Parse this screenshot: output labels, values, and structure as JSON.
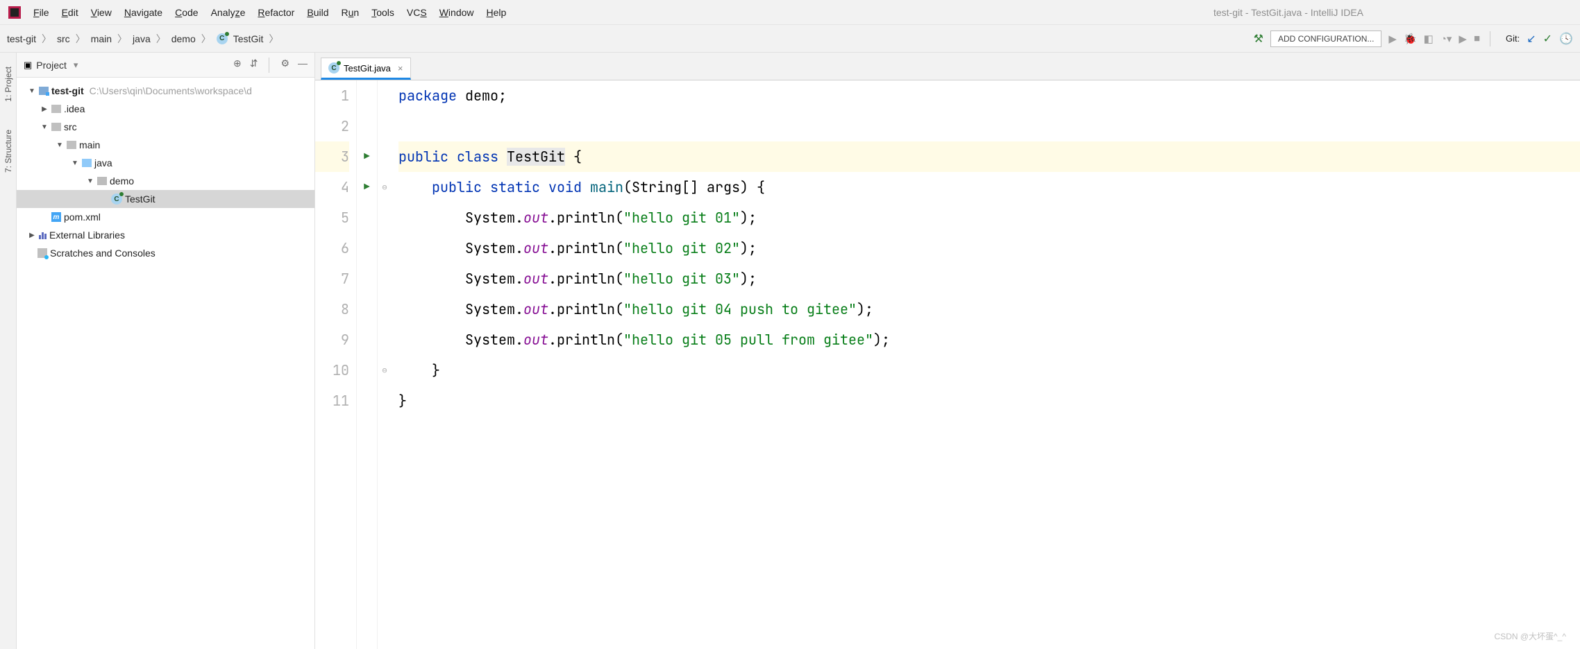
{
  "menu": {
    "items": [
      "File",
      "Edit",
      "View",
      "Navigate",
      "Code",
      "Analyze",
      "Refactor",
      "Build",
      "Run",
      "Tools",
      "VCS",
      "Window",
      "Help"
    ],
    "underline": [
      "F",
      "E",
      "V",
      "N",
      "C",
      "",
      "R",
      "B",
      "u",
      "T",
      "",
      "W",
      "H"
    ]
  },
  "window_title": "test-git - TestGit.java - IntelliJ IDEA",
  "breadcrumbs": [
    "test-git",
    "src",
    "main",
    "java",
    "demo",
    "TestGit"
  ],
  "toolbar": {
    "add_config": "ADD CONFIGURATION...",
    "git_label": "Git:"
  },
  "left_stripe": {
    "project": "1: Project",
    "structure": "7: Structure"
  },
  "project_panel": {
    "title": "Project",
    "root": {
      "name": "test-git",
      "path": "C:\\Users\\qin\\Documents\\workspace\\d"
    },
    "nodes": {
      "idea": ".idea",
      "src": "src",
      "main": "main",
      "java": "java",
      "demo": "demo",
      "testgit": "TestGit",
      "pom": "pom.xml",
      "ext": "External Libraries",
      "scratch": "Scratches and Consoles"
    }
  },
  "editor": {
    "tab": "TestGit.java",
    "lines": {
      "l1_pkg": "package",
      "l1_name": " demo;",
      "l3_pub": "public",
      "l3_cls": "class",
      "l3_name": "TestGit",
      "l3_brace": " {",
      "l4_pub": "public",
      "l4_static": "static",
      "l4_void": "void",
      "l4_main": "main",
      "l4_sig": "(String[] args) {",
      "l5_sys": "System.",
      "l5_out": "out",
      "l5_call": ".println(",
      "l5_str": "\"hello git 01\"",
      "l5_end": ");",
      "l6_str": "\"hello git 02\"",
      "l7_str": "\"hello git 03\"",
      "l8_str": "\"hello git 04 push to gitee\"",
      "l9_str": "\"hello git 05 pull from gitee\"",
      "l10": "}",
      "l11": "}"
    },
    "line_numbers": [
      "1",
      "2",
      "3",
      "4",
      "5",
      "6",
      "7",
      "8",
      "9",
      "10",
      "11"
    ]
  },
  "watermark": "CSDN @大坏蛋^_^"
}
